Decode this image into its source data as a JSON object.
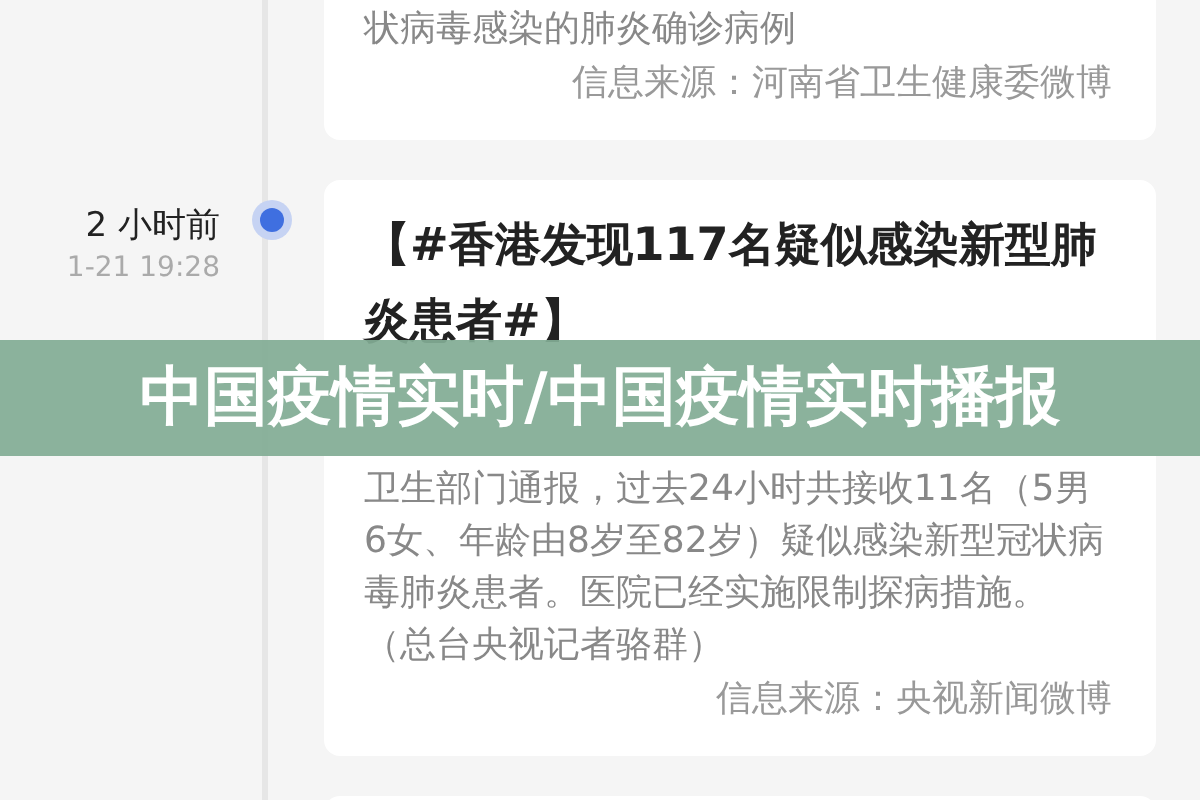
{
  "timeline": [
    {
      "body": "状病毒感染的肺炎确诊病例",
      "source": "信息来源：河南省卫生健康委微博"
    },
    {
      "relative_time": "2 小时前",
      "timestamp": "1-21 19:28",
      "title": "【#香港发现117名疑似感染新型肺炎患者#】",
      "body": "卫生部门通报，过去24小时共接收11名（5男6女、年龄由8岁至82岁）疑似感染新型冠状病毒肺炎患者。医院已经实施限制探病措施。（总台央视记者骆群）",
      "source": "信息来源：央视新闻微博"
    }
  ],
  "banner": {
    "text": "中国疫情实时/中国疫情实时播报"
  }
}
